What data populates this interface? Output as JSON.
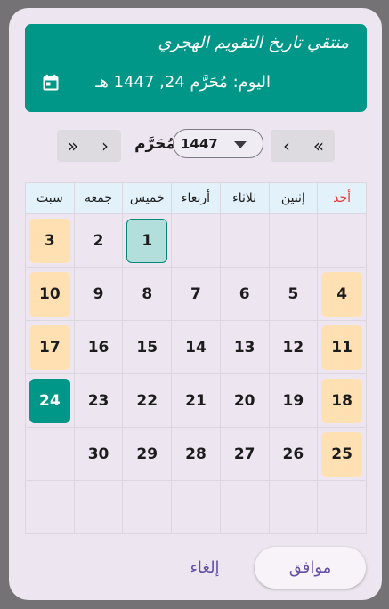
{
  "header": {
    "title": "منتقي تاريخ التقويم الهجري",
    "today_label": "اليوم:",
    "today_date": "مُحَرَّم 24, 1447 هـ",
    "icon": "calendar-icon"
  },
  "nav": {
    "prev_year": "«",
    "prev_month": "‹",
    "next_month": "›",
    "next_year": "»",
    "month": "مُحَرَّم",
    "year": "1447"
  },
  "weekdays": [
    "سبت",
    "جمعة",
    "خميس",
    "أربعاء",
    "ثلاثاء",
    "إثنين",
    "أحد"
  ],
  "weeks": [
    [
      "3",
      "2",
      "1",
      "",
      "",
      "",
      ""
    ],
    [
      "10",
      "9",
      "8",
      "7",
      "6",
      "5",
      "4"
    ],
    [
      "17",
      "16",
      "15",
      "14",
      "13",
      "12",
      "11"
    ],
    [
      "24",
      "23",
      "22",
      "21",
      "20",
      "19",
      "18"
    ],
    [
      "",
      "30",
      "29",
      "28",
      "27",
      "26",
      "25"
    ],
    [
      "",
      "",
      "",
      "",
      "",
      "",
      ""
    ]
  ],
  "selected_day": "24",
  "first_day": "1",
  "colors": {
    "accent": "#009688",
    "weekend": "#ffe0b2",
    "first_day": "#b2dfdb",
    "sunday_header": "#e53935",
    "button_text": "#6750a4"
  },
  "actions": {
    "ok": "موافق",
    "cancel": "إلغاء"
  }
}
